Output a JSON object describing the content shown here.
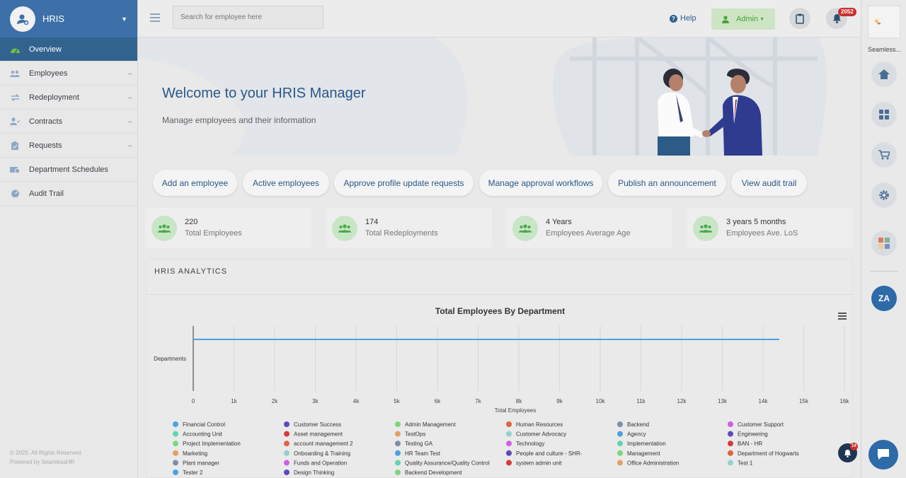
{
  "sidebar": {
    "brand": "HRIS",
    "items": [
      {
        "label": "Overview",
        "icon": "dashboard-icon",
        "dots": ""
      },
      {
        "label": "Employees",
        "icon": "users-icon",
        "dots": "..."
      },
      {
        "label": "Redeployment",
        "icon": "exchange-icon",
        "dots": "..."
      },
      {
        "label": "Contracts",
        "icon": "user-edit-icon",
        "dots": "..."
      },
      {
        "label": "Requests",
        "icon": "clipboard-icon",
        "dots": "..."
      },
      {
        "label": "Department Schedules",
        "icon": "schedule-icon",
        "dots": ""
      },
      {
        "label": "Audit Trail",
        "icon": "gauge-icon",
        "dots": ""
      }
    ],
    "footer_copyright": "© 2025. All Rights Reserved.",
    "footer_powered": "Powered by SeamlessHR"
  },
  "topbar": {
    "search_placeholder": "Search for employee here",
    "help_label": "Help",
    "admin_label": "Admin",
    "notification_count": "2052"
  },
  "rail": {
    "app_name": "Seamless...",
    "avatar_initials": "ZA",
    "chat_badge": "14"
  },
  "hero": {
    "title": "Welcome to your HRIS Manager",
    "subtitle": "Manage employees and their information"
  },
  "quick_actions": [
    "Add an employee",
    "Active employees",
    "Approve profile update requests",
    "Manage approval workflows",
    "Publish an announcement",
    "View audit trail"
  ],
  "stats": [
    {
      "value": "220",
      "label": "Total Employees"
    },
    {
      "value": "174",
      "label": "Total Redeployments"
    },
    {
      "value": "4 Years",
      "label": "Employees Average Age"
    },
    {
      "value": "3 years 5 months",
      "label": "Employees Ave. LoS"
    }
  ],
  "analytics": {
    "title": "HRIS ANALYTICS"
  },
  "chart_data": {
    "type": "bar",
    "orientation": "horizontal",
    "title": "Total Employees By Department",
    "xlabel": "Total Employees",
    "ylabel": "",
    "categories": [
      "Departments"
    ],
    "xlim": [
      0,
      16000
    ],
    "ticks": [
      "0",
      "1k",
      "2k",
      "3k",
      "4k",
      "5k",
      "6k",
      "7k",
      "8k",
      "9k",
      "10k",
      "11k",
      "12k",
      "13k",
      "14k",
      "15k",
      "16k"
    ],
    "grid": true,
    "legend_position": "bottom",
    "series": [
      {
        "name": "Financial Control",
        "color": "#4aa3df",
        "value": 14400
      },
      {
        "name": "Customer Success",
        "color": "#5b4bbf",
        "value": 0
      },
      {
        "name": "Admin Management",
        "color": "#7ed67e",
        "value": 0
      },
      {
        "name": "Human Resources",
        "color": "#e0643c",
        "value": 0
      },
      {
        "name": "Backend",
        "color": "#7f8da6",
        "value": 0
      },
      {
        "name": "Customer Support",
        "color": "#cf5fe0",
        "value": 0
      },
      {
        "name": "Accounting Unit",
        "color": "#5fd6a8",
        "value": 0
      },
      {
        "name": "Asset management",
        "color": "#d63a3a",
        "value": 0
      },
      {
        "name": "TestOps",
        "color": "#e3a062",
        "value": 0
      },
      {
        "name": "Customer Advocacy",
        "color": "#8fd3cc",
        "value": 0
      },
      {
        "name": "Agency",
        "color": "#4aa3df",
        "value": 0
      },
      {
        "name": "Engineering",
        "color": "#5b4bbf",
        "value": 0
      },
      {
        "name": "Project Implementation",
        "color": "#7ed67e",
        "value": 0
      },
      {
        "name": "account management 2",
        "color": "#e0643c",
        "value": 0
      },
      {
        "name": "Testing GA",
        "color": "#7f8da6",
        "value": 0
      },
      {
        "name": "Technology",
        "color": "#cf5fe0",
        "value": 0
      },
      {
        "name": "Implementation",
        "color": "#5fd6a8",
        "value": 0
      },
      {
        "name": "BAN - HR",
        "color": "#d63a3a",
        "value": 0
      },
      {
        "name": "Marketing",
        "color": "#e3a062",
        "value": 0
      },
      {
        "name": "Onboarding & Training",
        "color": "#8fd3cc",
        "value": 0
      },
      {
        "name": "HR Team Test",
        "color": "#4aa3df",
        "value": 0
      },
      {
        "name": "People and culture - SHR-",
        "color": "#5b4bbf",
        "value": 0
      },
      {
        "name": "Management",
        "color": "#7ed67e",
        "value": 0
      },
      {
        "name": "Department of Hogwarts",
        "color": "#e0643c",
        "value": 0
      },
      {
        "name": "Plant manager",
        "color": "#7f8da6",
        "value": 0
      },
      {
        "name": "Funds and Operation",
        "color": "#cf5fe0",
        "value": 0
      },
      {
        "name": "Quality Assurance/Quality Control",
        "color": "#5fd6a8",
        "value": 0
      },
      {
        "name": "system admin unit",
        "color": "#d63a3a",
        "value": 0
      },
      {
        "name": "Office Administration",
        "color": "#e3a062",
        "value": 0
      },
      {
        "name": "Test 1",
        "color": "#8fd3cc",
        "value": 0
      },
      {
        "name": "Tester 2",
        "color": "#4aa3df",
        "value": 0
      },
      {
        "name": "Design Thinking",
        "color": "#5b4bbf",
        "value": 0
      },
      {
        "name": "Backend Development",
        "color": "#7ed67e",
        "value": 0
      }
    ]
  }
}
